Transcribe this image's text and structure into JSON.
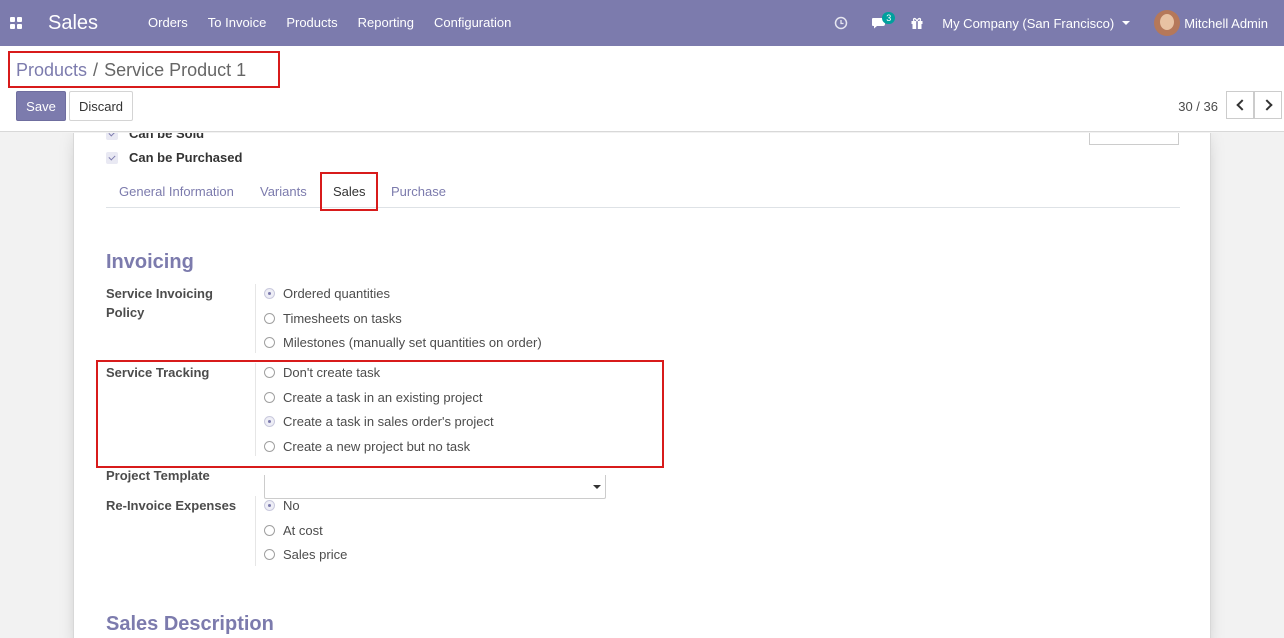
{
  "navbar": {
    "app_name": "Sales",
    "menu": [
      "Orders",
      "To Invoice",
      "Products",
      "Reporting",
      "Configuration"
    ],
    "chat_count": "3",
    "company": "My Company (San Francisco)",
    "user": "Mitchell Admin",
    "bg_color": "#7c7bad"
  },
  "breadcrumb": {
    "parent": "Products",
    "separator": "/",
    "current": "Service Product 1"
  },
  "buttons": {
    "save": "Save",
    "discard": "Discard"
  },
  "pager": {
    "value": "30 / 36"
  },
  "checks": {
    "can_be_sold": "Can be Sold",
    "can_be_purchased": "Can be Purchased"
  },
  "tabs": [
    "General Information",
    "Variants",
    "Sales",
    "Purchase"
  ],
  "active_tab": "Sales",
  "invoicing": {
    "title": "Invoicing",
    "service_invoicing_policy": {
      "label_line1": "Service Invoicing",
      "label_line2": "Policy",
      "options": [
        "Ordered quantities",
        "Timesheets on tasks",
        "Milestones (manually set quantities on order)"
      ],
      "selected": "Ordered quantities"
    },
    "service_tracking": {
      "label": "Service Tracking",
      "options": [
        "Don't create task",
        "Create a task in an existing project",
        "Create a task in sales order's project",
        "Create a new project but no task"
      ],
      "selected": "Create a task in sales order's project"
    },
    "project_template": {
      "label": "Project Template",
      "value": ""
    },
    "reinvoice_expenses": {
      "label": "Re-Invoice Expenses",
      "options": [
        "No",
        "At cost",
        "Sales price"
      ],
      "selected": "No"
    }
  },
  "sales_description": {
    "title": "Sales Description"
  }
}
